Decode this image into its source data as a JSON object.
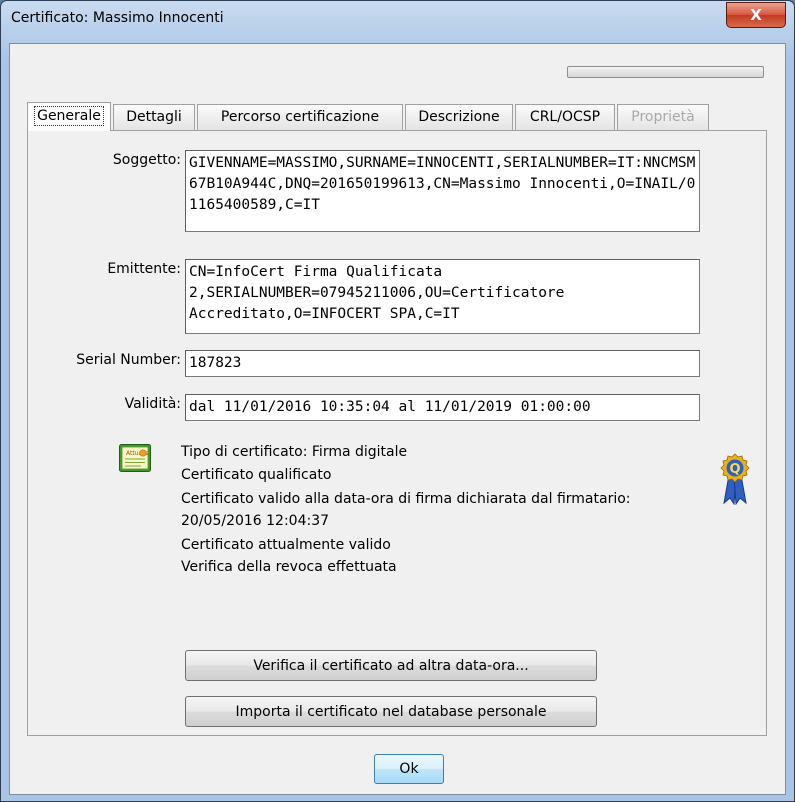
{
  "window": {
    "title": "Certificato: Massimo Innocenti",
    "close_label": "X"
  },
  "tabs": [
    {
      "label": "Generale",
      "state": "active"
    },
    {
      "label": "Dettagli",
      "state": "normal"
    },
    {
      "label": "Percorso certificazione",
      "state": "normal"
    },
    {
      "label": "Descrizione",
      "state": "normal"
    },
    {
      "label": "CRL/OCSP",
      "state": "normal"
    },
    {
      "label": "Proprietà",
      "state": "disabled"
    }
  ],
  "fields": {
    "subject": {
      "label": "Soggetto:",
      "value": "GIVENNAME=MASSIMO,SURNAME=INNOCENTI,SERIALNUMBER=IT:NNCMSM67B10A944C,DNQ=201650199613,CN=Massimo Innocenti,O=INAIL/01165400589,C=IT"
    },
    "issuer": {
      "label": "Emittente:",
      "value": "CN=InfoCert Firma Qualificata 2,SERIALNUMBER=07945211006,OU=Certificatore Accreditato,O=INFOCERT SPA,C=IT"
    },
    "serial": {
      "label": "Serial Number:",
      "value": "187823"
    },
    "validity": {
      "label": "Validità:",
      "value": "dal 11/01/2016 10:35:04 al 11/01/2019 01:00:00"
    }
  },
  "info": {
    "cert_type": "Tipo di certificato: Firma digitale",
    "qualified": "Certificato qualificato",
    "valid_at_line1": "Certificato valido alla data-ora di firma dichiarata dal firmatario:",
    "valid_at_line2": "20/05/2016 12:04:37",
    "currently_valid": "Certificato attualmente valido",
    "revocation": "Verifica della revoca effettuata",
    "cert_icon_text": "Attualis",
    "ribbon_letter": "Q"
  },
  "buttons": {
    "verify_other_date": "Verifica il certificato ad altra data-ora...",
    "import": "Importa il certificato nel database personale",
    "ok": "Ok"
  },
  "colors": {
    "accent_green": "#3c9a2e",
    "ribbon_blue": "#2f5fbf",
    "ribbon_gold": "#e8b21a"
  }
}
